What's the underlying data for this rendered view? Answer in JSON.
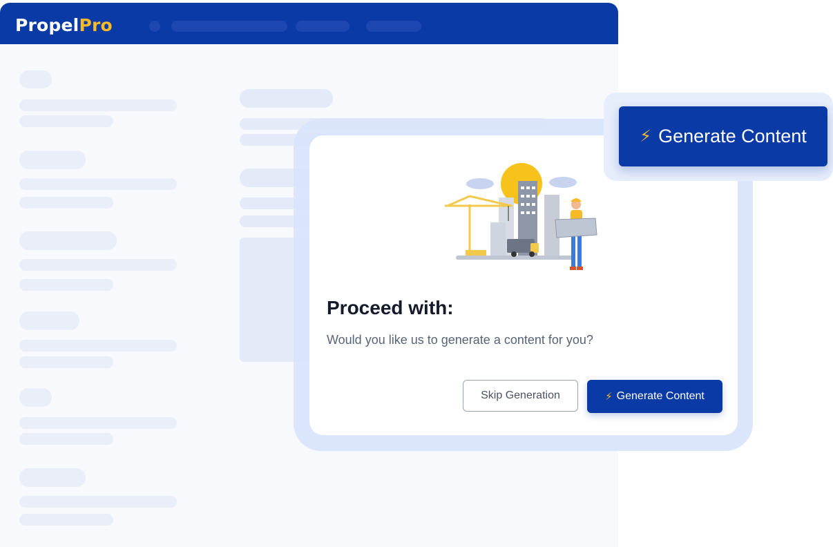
{
  "app": {
    "brand_part1": "Propel",
    "brand_part2": "Pro"
  },
  "modal": {
    "title": "Proceed with:",
    "message": "Would you like us to generate a content for you?",
    "skip_label": "Skip Generation",
    "generate_label": "Generate Content",
    "illustration_icon": "construction-site-illustration"
  },
  "callout": {
    "generate_label": "Generate Content",
    "icon": "lightning-bolt-icon"
  },
  "colors": {
    "brand_blue": "#0a3aa6",
    "brand_yellow": "#f6b928"
  }
}
